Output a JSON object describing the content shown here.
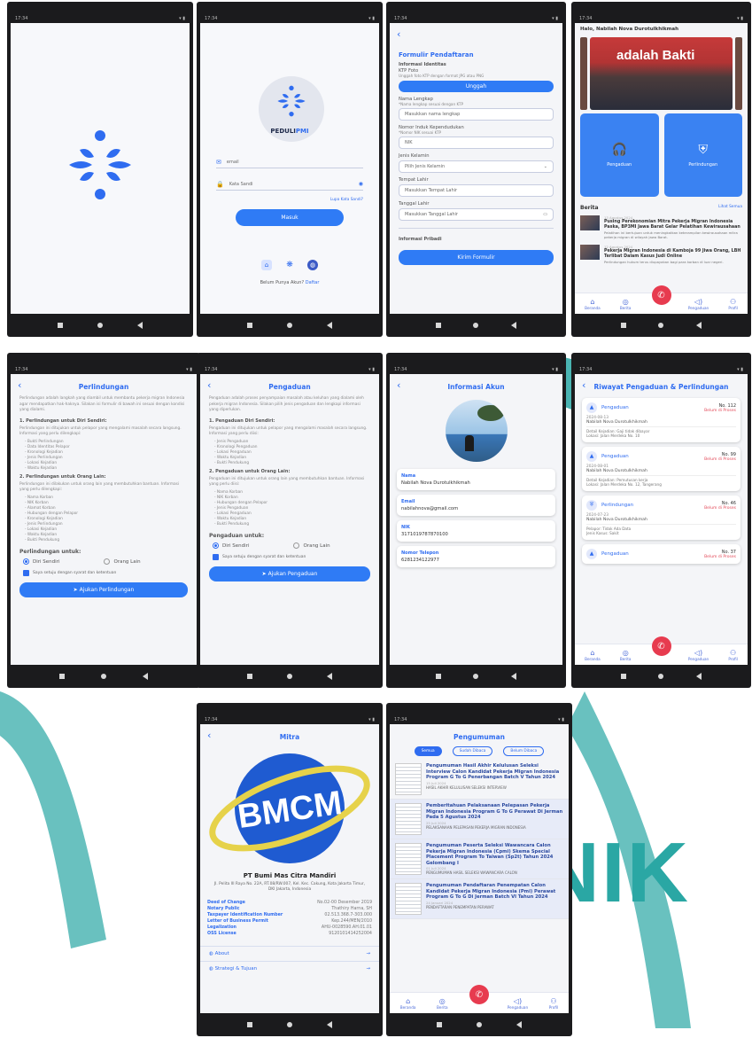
{
  "watermark": {
    "text": "NIK",
    "color": "#2aa7a4"
  },
  "status_time": "17:34",
  "login": {
    "brand_prefix": "PEDULI",
    "brand_suffix": "PMI",
    "email_value": "email",
    "password_value": "Kata Sandi",
    "forgot_label": "Lupa Kata Sandi?",
    "login_button": "Masuk",
    "register_prompt": "Belum Punya Akun?",
    "register_link": "Daftar"
  },
  "registration": {
    "title": "Formulir Pendaftaran",
    "section_identity": "Informasi Identitas",
    "photo_label": "KTP Foto",
    "photo_hint": "Unggah foto KTP dengan format JPG atau PNG",
    "upload_button": "Unggah",
    "name_label": "Nama Lengkap",
    "name_hint": "*Nama lengkap sesuai dengan KTP",
    "name_value": "Masukkan nama lengkap",
    "nik_label": "Nomor Induk Kependudukan",
    "nik_hint": "*Nomor NIK sesuai KTP",
    "nik_value": "NIK",
    "gender_label": "Jenis Kelamin",
    "gender_value": "Pilih Jenis Kelamin",
    "birthplace_label": "Tempat Lahir",
    "birthplace_value": "Masukkan Tempat Lahir",
    "birthdate_label": "Tanggal Lahir",
    "birthdate_value": "Masukkan Tanggal Lahir",
    "section_personal": "Informasi Pribadi",
    "submit_button": "Kirim Formulir"
  },
  "home": {
    "greeting": "Halo, Nabilah Nova Durotulkhikmah",
    "banner_text": "adalah Bakti",
    "tile_left": "Pengaduan",
    "tile_right": "Perlindungan",
    "news_title": "Berita",
    "news_more": "Lihat Semua",
    "news": [
      {
        "date": "13 Agustus 2024",
        "title": "Pusing Perekonomian Mitra Pekerja Migran Indonesia Paska, BP3MI Jawa Barat Gelar Pelatihan Kewirausahaan",
        "snippet": "Pelatihan ini bertujuan untuk meningkatkan keterampilan kewirausahaan mitra pekerja migran di wilayah Jawa Barat."
      },
      {
        "date": "12 Agustus 2024",
        "title": "Pekerja Migran Indonesia di Kamboja 99 Jiwa Orang, LBH Terlibat Dalam Kasus Judi Online",
        "snippet": "Perlindungan hukum terus diupayakan bagi para korban di luar negeri."
      }
    ],
    "tabs": [
      "Beranda",
      "Berita",
      "Pengaduan",
      "Profil"
    ]
  },
  "protection": {
    "title": "Perlindungan",
    "intro": "Perlindungan adalah langkah yang diambil untuk membantu pekerja migran Indonesia agar mendapatkan hak-haknya. Silakan isi formulir di bawah ini sesuai dengan kondisi yang dialami.",
    "sec1": "1. Perlindungan untuk Diri Sendiri:",
    "sec1_desc": "Perlindungan ini ditujukan untuk pelapor yang mengalami masalah secara langsung. Informasi yang perlu dilengkapi:",
    "sec1_items": [
      "- Bukti Perlindungan",
      "- Data Identitas Pelapor",
      "- Kronologi Kejadian",
      "- Jenis Perlindungan",
      "- Lokasi Kejadian",
      "- Waktu Kejadian"
    ],
    "sec2": "2. Perlindungan untuk Orang Lain:",
    "sec2_desc": "Perlindungan ini dilakukan untuk orang lain yang membutuhkan bantuan. Informasi yang perlu dilengkapi:",
    "sec2_items": [
      "- Nama Korban",
      "- NIK Korban",
      "- Alamat Korban",
      "- Hubungan dengan Pelapor",
      "- Kronologi Kejadian",
      "- Jenis Perlindungan",
      "- Lokasi Kejadian",
      "- Waktu Kejadian",
      "- Bukti Pendukung"
    ],
    "for_label": "Perlindungan untuk:",
    "opt_self": "Diri Sendiri",
    "opt_other": "Orang Lain",
    "agree": "Saya setuju dengan syarat dan ketentuan",
    "submit": "Ajukan Perlindungan"
  },
  "complaint": {
    "title": "Pengaduan",
    "intro": "Pengaduan adalah proses penyampaian masalah atau keluhan yang dialami oleh pekerja migran Indonesia. Silakan pilih jenis pengaduan dan lengkapi informasi yang diperlukan.",
    "sec1": "1. Pengaduan Diri Sendiri:",
    "sec1_desc": "Pengaduan ini ditujukan untuk pelapor yang mengalami masalah secara langsung. Informasi yang perlu diisi:",
    "sec1_items": [
      "- Jenis Pengaduan",
      "- Kronologi Pengaduan",
      "- Lokasi Pengaduan",
      "- Waktu Kejadian",
      "- Bukti Pendukung"
    ],
    "sec2": "2. Pengaduan untuk Orang Lain:",
    "sec2_desc": "Pengaduan ini ditujukan untuk orang lain yang membutuhkan bantuan. Informasi yang perlu diisi:",
    "sec2_items": [
      "- Nama Korban",
      "- NIK Korban",
      "- Hubungan dengan Pelapor",
      "- Jenis Pengaduan",
      "- Lokasi Pengaduan",
      "- Waktu Kejadian",
      "- Bukti Pendukung"
    ],
    "for_label": "Pengaduan untuk:",
    "opt_self": "Diri Sendiri",
    "opt_other": "Orang Lain",
    "agree": "Saya setuju dengan syarat dan ketentuan",
    "submit": "Ajukan Pengaduan"
  },
  "account": {
    "title": "Informasi Akun",
    "name_label": "Nama",
    "name_value": "Nabilah Nova Durotulkhikmah",
    "email_label": "Email",
    "email_value": "nabilahnova@gmail.com",
    "nik_label": "NIK",
    "nik_value": "3171019787870100",
    "phone_label": "Nomor Telepon",
    "phone_value": "6281234122977"
  },
  "history": {
    "title": "Riwayat Pengaduan & Perlindungan",
    "items": [
      {
        "type": "Pengaduan",
        "no": "No. 112",
        "status": "Belum di Proses",
        "date": "2024-08-13",
        "name": "Nabilah Nova Durotulkhikmah",
        "detail": "Detail Kejadian: Gaji tidak dibayar",
        "loc": "Lokasi: Jalan Merdeka No. 10"
      },
      {
        "type": "Pengaduan",
        "no": "No. 99",
        "status": "Belum di Proses",
        "date": "2024-08-01",
        "name": "Nabilah Nova Durotulkhikmah",
        "detail": "Detail Kejadian: Pemutusan kerja",
        "loc": "Lokasi: Jalan Merdeka No. 12, Tangerang"
      },
      {
        "type": "Perlindungan",
        "no": "No. 46",
        "status": "Belum di Proses",
        "date": "2024-07-23",
        "name": "Nabilah Nova Durotulkhikmah",
        "detail": "Pelapor: Tidak Ada Data",
        "loc": "Jenis Kasus: Sakit"
      },
      {
        "type": "Pengaduan",
        "no": "No. 37",
        "status": "Belum di Proses",
        "date": "",
        "name": "",
        "detail": "",
        "loc": ""
      }
    ]
  },
  "partner": {
    "title": "Mitra",
    "logo_text": "BMCM",
    "company": "PT Bumi Mas Citra Mandiri",
    "address": "Jl. Pelita III Raya No. 22A, RT.08/RW.007, Kel. Kec. Cakung, Kota Jakarta Timur, DKI Jakarta, Indonesia",
    "fields": [
      {
        "k": "Deed of Change",
        "v": "No.02-00 Desember 2019"
      },
      {
        "k": "Notary Public",
        "v": "Thathiry Harna, SH"
      },
      {
        "k": "Taxpayer Identification Number",
        "v": "02.513.368.7-303.000"
      },
      {
        "k": "Letter of Business Permit",
        "v": "Kep.244/MEN/2010"
      },
      {
        "k": "Legalization",
        "v": "AHU-0028590.AH.01.01"
      },
      {
        "k": "OSS License",
        "v": "9120101414252004"
      }
    ],
    "link_about": "About",
    "link_strategy": "Strategi & Tujuan"
  },
  "announcements": {
    "title": "Pengumuman",
    "filters": [
      "Semua",
      "Sudah Dibaca",
      "Belum Dibaca"
    ],
    "items": [
      {
        "title": "Pengumuman Hasil Akhir Kelulusan Seleksi Interview Calon Kandidat Pekerja Migran Indonesia Program G To G Penerbangan Batch V Tahun 2024",
        "date": "15 Juli 2024",
        "snippet": "HASIL AKHIR KELULUSAN SELEKSI INTERVIEW"
      },
      {
        "title": "Pemberitahuan Pelaksanaan Pelepasan Pekerja Migran Indonesia Program G To G Perawat Di Jerman Pada 5 Agustus 2024",
        "date": "25 Juli 2024",
        "snippet": "PELAKSANAAN PELEPASAN PEKERJA MIGRAN INDONESIA"
      },
      {
        "title": "Pengumuman Peserta Seleksi Wawancara Calon Pekerja Migran Indonesia (Cpmi) Skema Special Placement Program To Taiwan (Sp2t) Tahun 2024 Gelombang I",
        "date": "01 Juli 2024",
        "snippet": "PENGUMUMAN HASIL SELEKSI WAWANCARA CALON"
      },
      {
        "title": "Pengumuman Pendaftaran Penempatan Calon Kandidat Pekerja Migran Indonesia (Pmi) Perawat Program G To G Di Jerman Batch VI Tahun 2024",
        "date": "24 Januari 2024",
        "snippet": "PENDAFTARAN PENEMPATAN PERAWAT"
      }
    ]
  }
}
